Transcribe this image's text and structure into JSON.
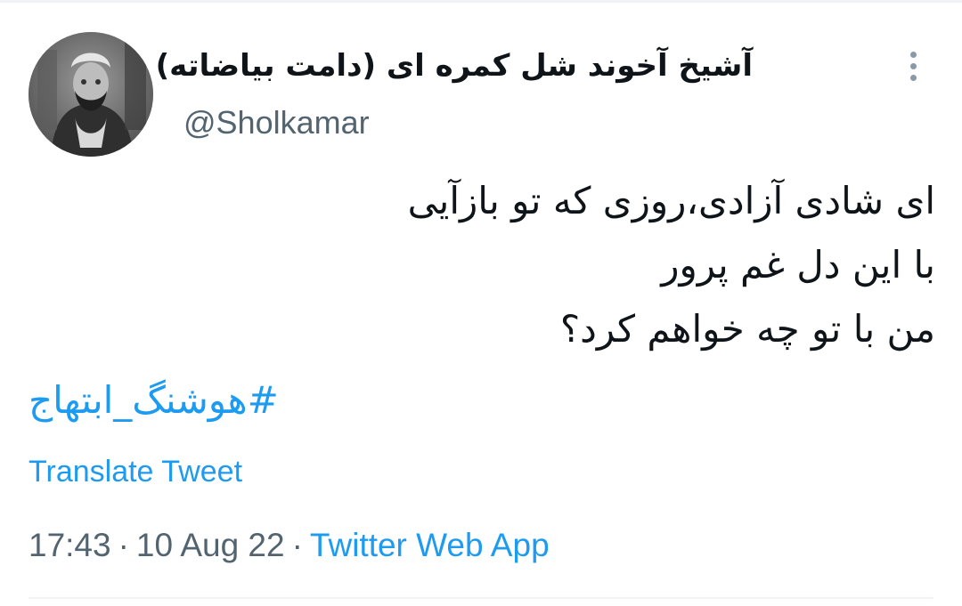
{
  "tweet": {
    "author": {
      "display_name": "آشیخ آخوند شل کمره ای (دامت بیاضاته)",
      "username": "@Sholkamar"
    },
    "text_lines": [
      "ای شادی آزادی،روزی که تو بازآیی",
      "با این دل غم پرور",
      "من با تو چه خواهم کرد؟"
    ],
    "hashtag": "#هوشنگ_ابتهاج",
    "translate_label": "Translate Tweet",
    "time": "17:43",
    "date": "10 Aug 22",
    "separator": "·",
    "source": "Twitter Web App"
  },
  "icons": {
    "more": "more-vertical-icon"
  },
  "colors": {
    "link": "#1d9bf0",
    "muted": "#536471",
    "text": "#0f1419"
  }
}
